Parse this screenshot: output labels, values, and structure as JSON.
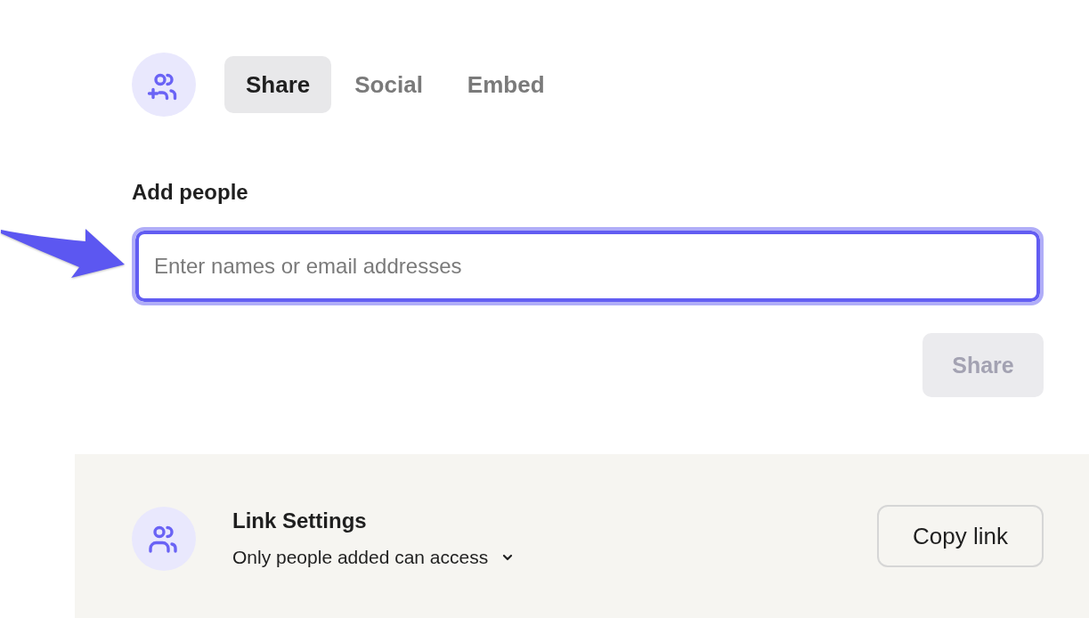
{
  "header": {
    "tabs": [
      {
        "label": "Share",
        "selected": true
      },
      {
        "label": "Social",
        "selected": false
      },
      {
        "label": "Embed",
        "selected": false
      }
    ]
  },
  "add_people": {
    "label": "Add people",
    "input": {
      "placeholder": "Enter names or email addresses",
      "focused": true
    },
    "share_button": {
      "label": "Share",
      "disabled": true
    }
  },
  "link_settings": {
    "title": "Link Settings",
    "access": "Only people added can access",
    "copy_button": {
      "label": "Copy link"
    }
  }
}
